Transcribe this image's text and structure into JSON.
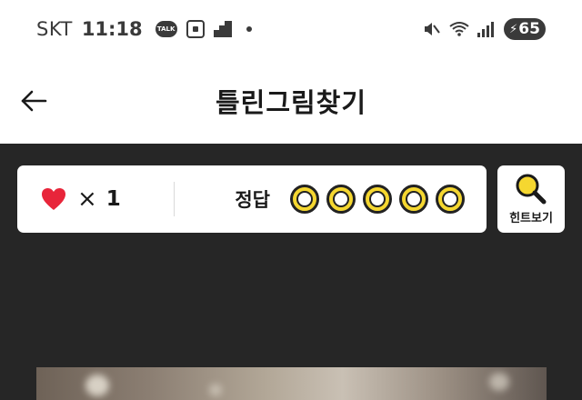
{
  "status_bar": {
    "carrier": "SKT",
    "time": "11:18",
    "talk_badge": "TALK",
    "battery_level": "65",
    "icons": [
      "talk-icon",
      "scan-icon",
      "stairs-icon",
      "dot-icon",
      "mute-icon",
      "wifi-icon",
      "signal-icon",
      "battery-icon"
    ]
  },
  "header": {
    "title": "틀린그림찾기",
    "back_icon": "arrow-left-icon"
  },
  "game_panel": {
    "lives_icon": "heart-icon",
    "times_symbol": "×",
    "lives_count": "1",
    "answer_label": "정답",
    "answers_total": 5,
    "answers_found": 0
  },
  "hint": {
    "label": "힌트보기",
    "icon": "magnifier-icon"
  },
  "colors": {
    "background_dark": "#262626",
    "surface": "#ffffff",
    "accent_yellow": "#f5d730",
    "heart_red": "#e8253a",
    "text_dark": "#1a1a1a"
  }
}
